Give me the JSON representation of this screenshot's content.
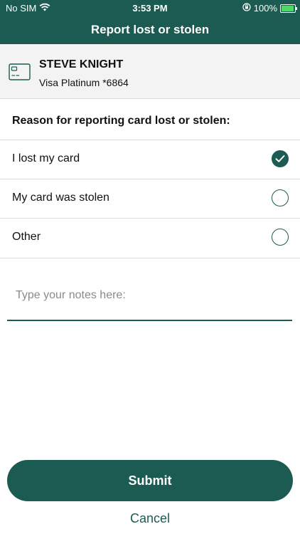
{
  "status_bar": {
    "carrier": "No SIM",
    "time": "3:53 PM",
    "battery": "100%",
    "icons": [
      "wifi-icon",
      "orientation-lock-icon",
      "battery-charging-icon"
    ]
  },
  "header": {
    "title": "Report lost or stolen"
  },
  "card": {
    "icon": "credit-card-icon",
    "holder": "STEVE KNIGHT",
    "description": "Visa Platinum *6864"
  },
  "reason": {
    "title": "Reason for reporting card lost or stolen:",
    "options": [
      {
        "label": "I lost my card",
        "selected": true
      },
      {
        "label": "My card was stolen",
        "selected": false
      },
      {
        "label": "Other",
        "selected": false
      }
    ]
  },
  "notes": {
    "value": "",
    "placeholder": "Type your notes here:"
  },
  "actions": {
    "submit_label": "Submit",
    "cancel_label": "Cancel"
  },
  "colors": {
    "accent": "#1c5b51",
    "card_block_bg": "#f3f3f3"
  }
}
